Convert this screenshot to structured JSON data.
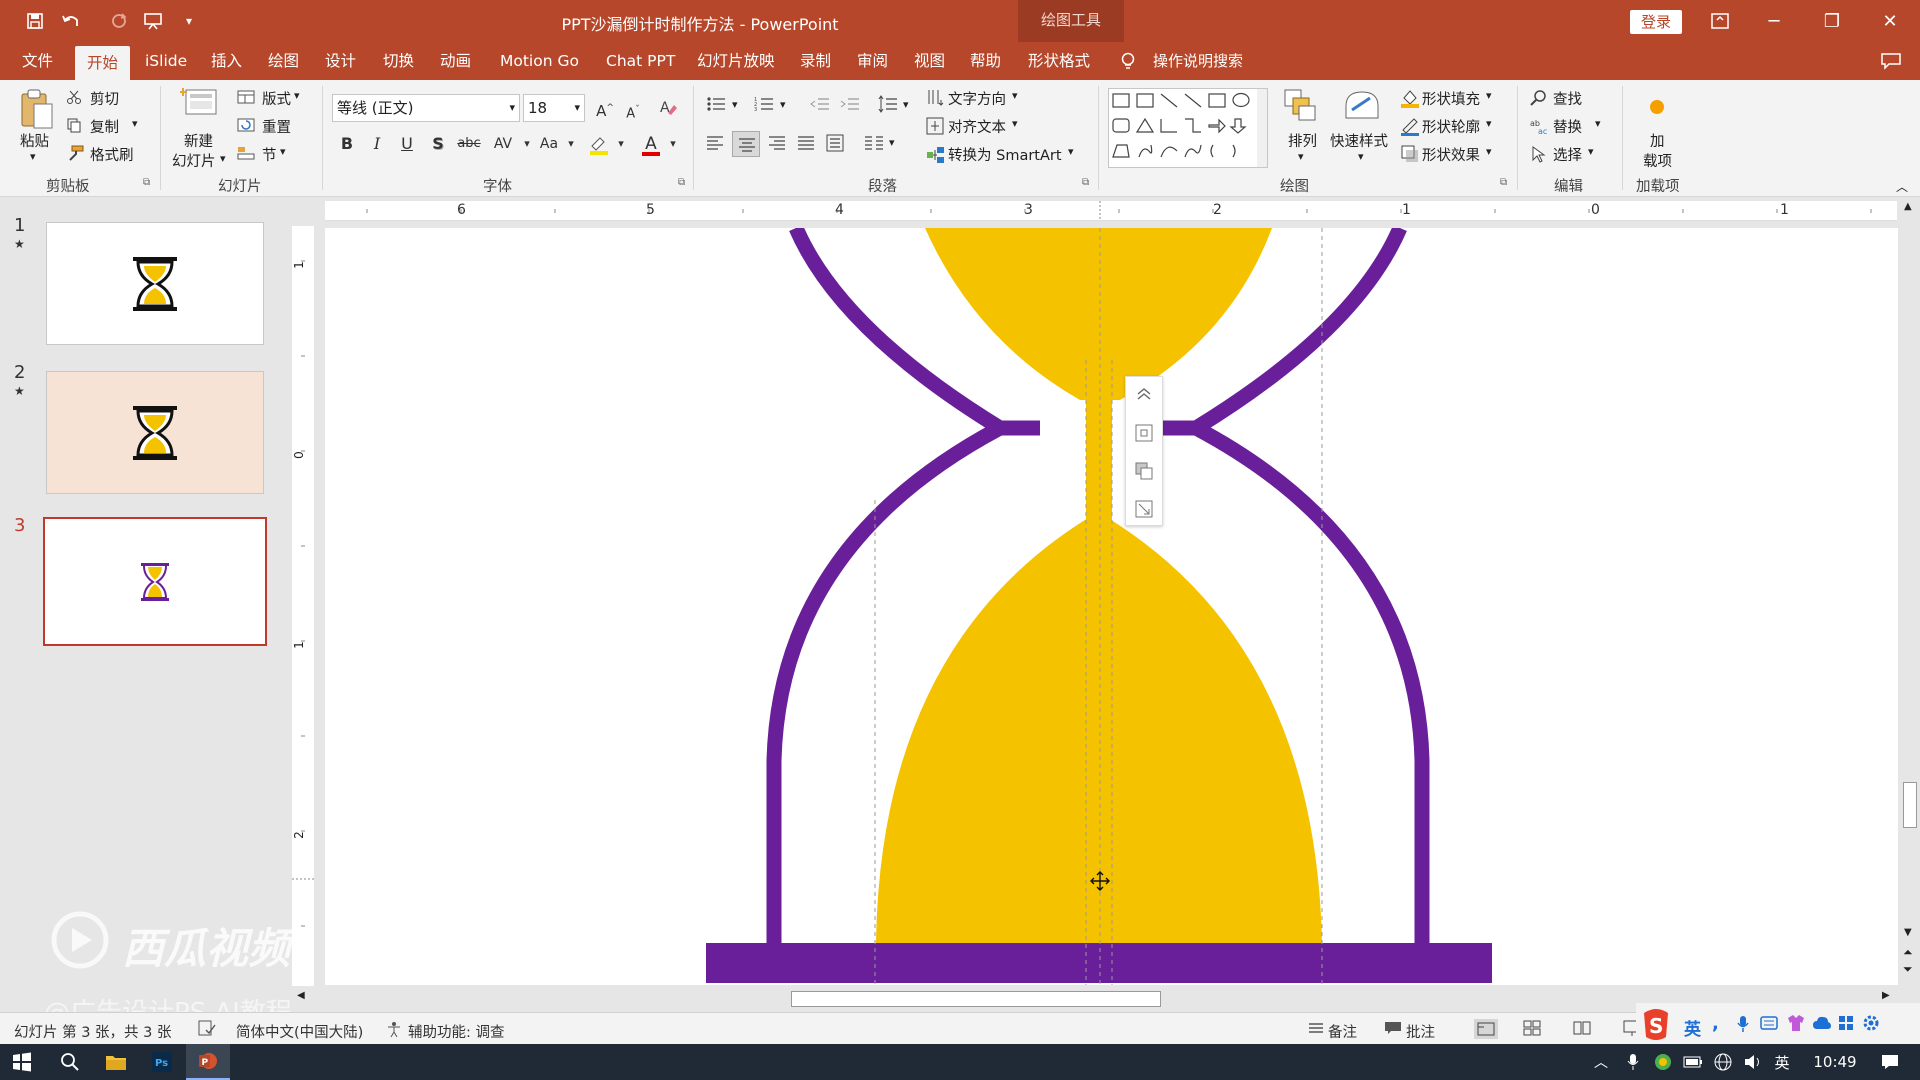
{
  "window": {
    "title": "PPT沙漏倒计时制作方法 - PowerPoint",
    "context_group": "绘图工具",
    "login": "登录",
    "minimize": "─",
    "restore": "❐",
    "maximize": "▭",
    "close": "✕"
  },
  "tabs": [
    {
      "label": "文件"
    },
    {
      "label": "开始"
    },
    {
      "label": "iSlide"
    },
    {
      "label": "插入"
    },
    {
      "label": "绘图"
    },
    {
      "label": "设计"
    },
    {
      "label": "切换"
    },
    {
      "label": "动画"
    },
    {
      "label": "Motion Go"
    },
    {
      "label": "Chat PPT"
    },
    {
      "label": "幻灯片放映"
    },
    {
      "label": "录制"
    },
    {
      "label": "审阅"
    },
    {
      "label": "视图"
    },
    {
      "label": "帮助"
    },
    {
      "label": "形状格式"
    }
  ],
  "tell_me": "操作说明搜索",
  "clipboard": {
    "paste": "粘贴",
    "cut": "剪切",
    "copy": "复制",
    "painter": "格式刷",
    "group": "剪贴板"
  },
  "slides_group": {
    "new_line1": "新建",
    "new_line2": "幻灯片",
    "layout": "版式",
    "reset": "重置",
    "section": "节",
    "group": "幻灯片"
  },
  "font": {
    "name": "等线 (正文)",
    "size": "18",
    "bold": "B",
    "italic": "I",
    "underline": "U",
    "shadow": "S",
    "strike": "abc",
    "spacing": "AV",
    "case": "Aa",
    "color_letter": "A",
    "group": "字体",
    "grow": "A",
    "shrink": "A"
  },
  "paragraph": {
    "text_direction": "文字方向",
    "align_text": "对齐文本",
    "smartart": "转换为 SmartArt",
    "group": "段落"
  },
  "drawing": {
    "arrange": "排列",
    "quick_styles": "快速样式",
    "fill": "形状填充",
    "outline": "形状轮廓",
    "effects": "形状效果",
    "group": "绘图"
  },
  "editing": {
    "find": "查找",
    "replace": "替换",
    "select": "选择",
    "group": "编辑"
  },
  "addins": {
    "line1": "加",
    "line2": "载项",
    "group": "加载项"
  },
  "thumbnails": [
    {
      "num": "1",
      "star": "★"
    },
    {
      "num": "2",
      "star": "★"
    },
    {
      "num": "3",
      "star": ""
    }
  ],
  "ruler": {
    "h": [
      "6",
      "5",
      "4",
      "3",
      "2",
      "1",
      "0",
      "1"
    ],
    "v": [
      "1",
      "0",
      "1",
      "2"
    ]
  },
  "status": {
    "slide_info": "幻灯片 第 3 张，共 3 张",
    "language": "简体中文(中国大陆)",
    "accessibility": "辅助功能: 调查",
    "notes": "备注",
    "comments": "批注"
  },
  "tray": {
    "ime": "英",
    "time": "10:49",
    "ime2": "英"
  },
  "watermark": {
    "line1": "西瓜视频",
    "line2": "@广告设计PS AI教程"
  },
  "colors": {
    "accent": "#b7472a",
    "hourglass_purple": "#6a1f9a",
    "sand": "#f5c200"
  }
}
